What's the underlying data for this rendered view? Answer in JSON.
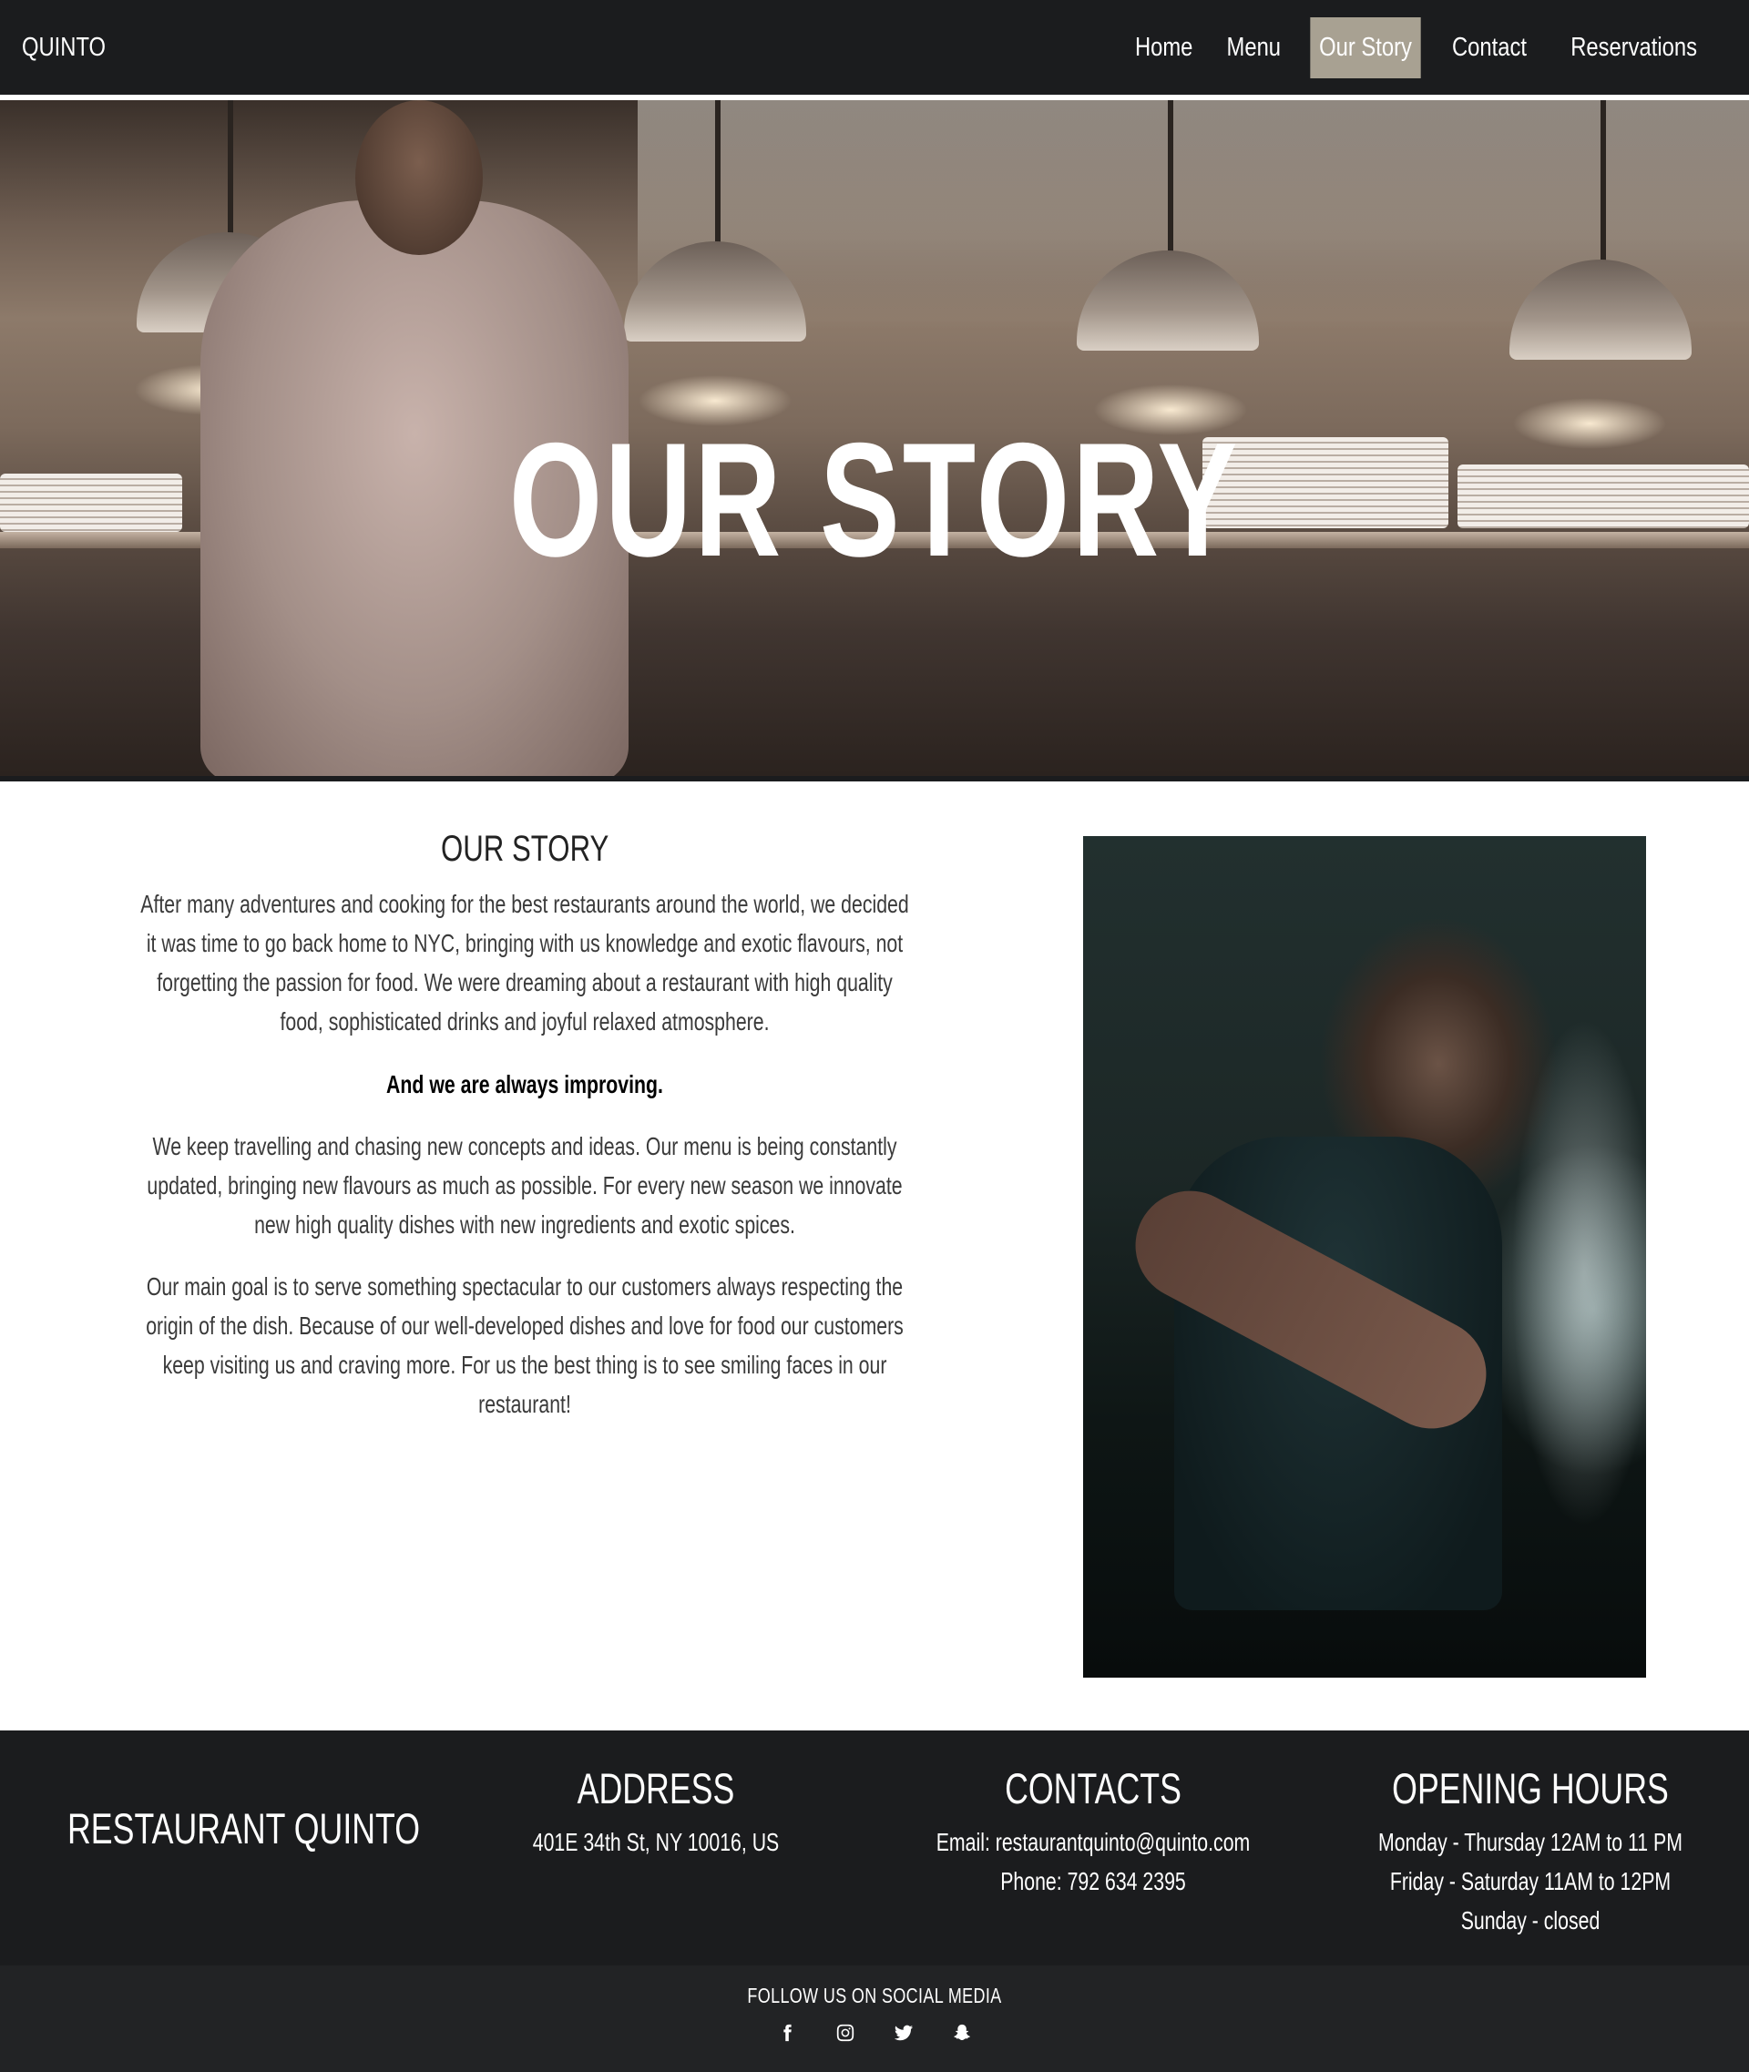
{
  "nav": {
    "brand": "QUINTO",
    "items": [
      {
        "label": "Home",
        "active": false
      },
      {
        "label": "Menu",
        "active": false
      },
      {
        "label": "Our Story",
        "active": true
      },
      {
        "label": "Contact",
        "active": false
      },
      {
        "label": "Reservations",
        "active": false
      }
    ],
    "active_color": "#a8a192",
    "background": "#1b1c1e"
  },
  "hero": {
    "title": "OUR STORY"
  },
  "story": {
    "heading": "OUR STORY",
    "paragraph1": "After many adventures and cooking for the best restaurants around the world, we decided it was time to go back home to NYC, bringing with us knowledge and exotic flavours, not forgetting the passion for food. We were dreaming about a restaurant with high quality food, sophisticated drinks and joyful relaxed atmosphere.",
    "highlight": "And we are always improving.",
    "paragraph2": "We keep travelling and chasing new concepts and ideas. Our menu is being constantly updated, bringing new flavours as much as possible. For every new season we innovate new high quality dishes with new ingredients and exotic spices.",
    "paragraph3": "Our main goal is to serve something spectacular to our customers always respecting the origin of the dish. Because of our well-developed dishes and love for food our customers keep visiting us and craving more. For us the best thing is to see smiling faces in our restaurant!"
  },
  "footer": {
    "brand": "RESTAURANT QUINTO",
    "address": {
      "heading": "ADDRESS",
      "line1": "401E 34th St, NY 10016, US"
    },
    "contacts": {
      "heading": "CONTACTS",
      "email": "Email: restaurantquinto@quinto.com",
      "phone": "Phone: 792 634 2395"
    },
    "hours": {
      "heading": "OPENING HOURS",
      "line1": "Monday - Thursday 12AM to 11 PM",
      "line2": "Friday - Saturday 11AM to 12PM",
      "line3": "Sunday - closed"
    },
    "social_label": "FOLLOW US ON SOCIAL MEDIA",
    "social_icons": [
      "facebook-icon",
      "instagram-icon",
      "twitter-icon",
      "snapchat-icon"
    ]
  }
}
